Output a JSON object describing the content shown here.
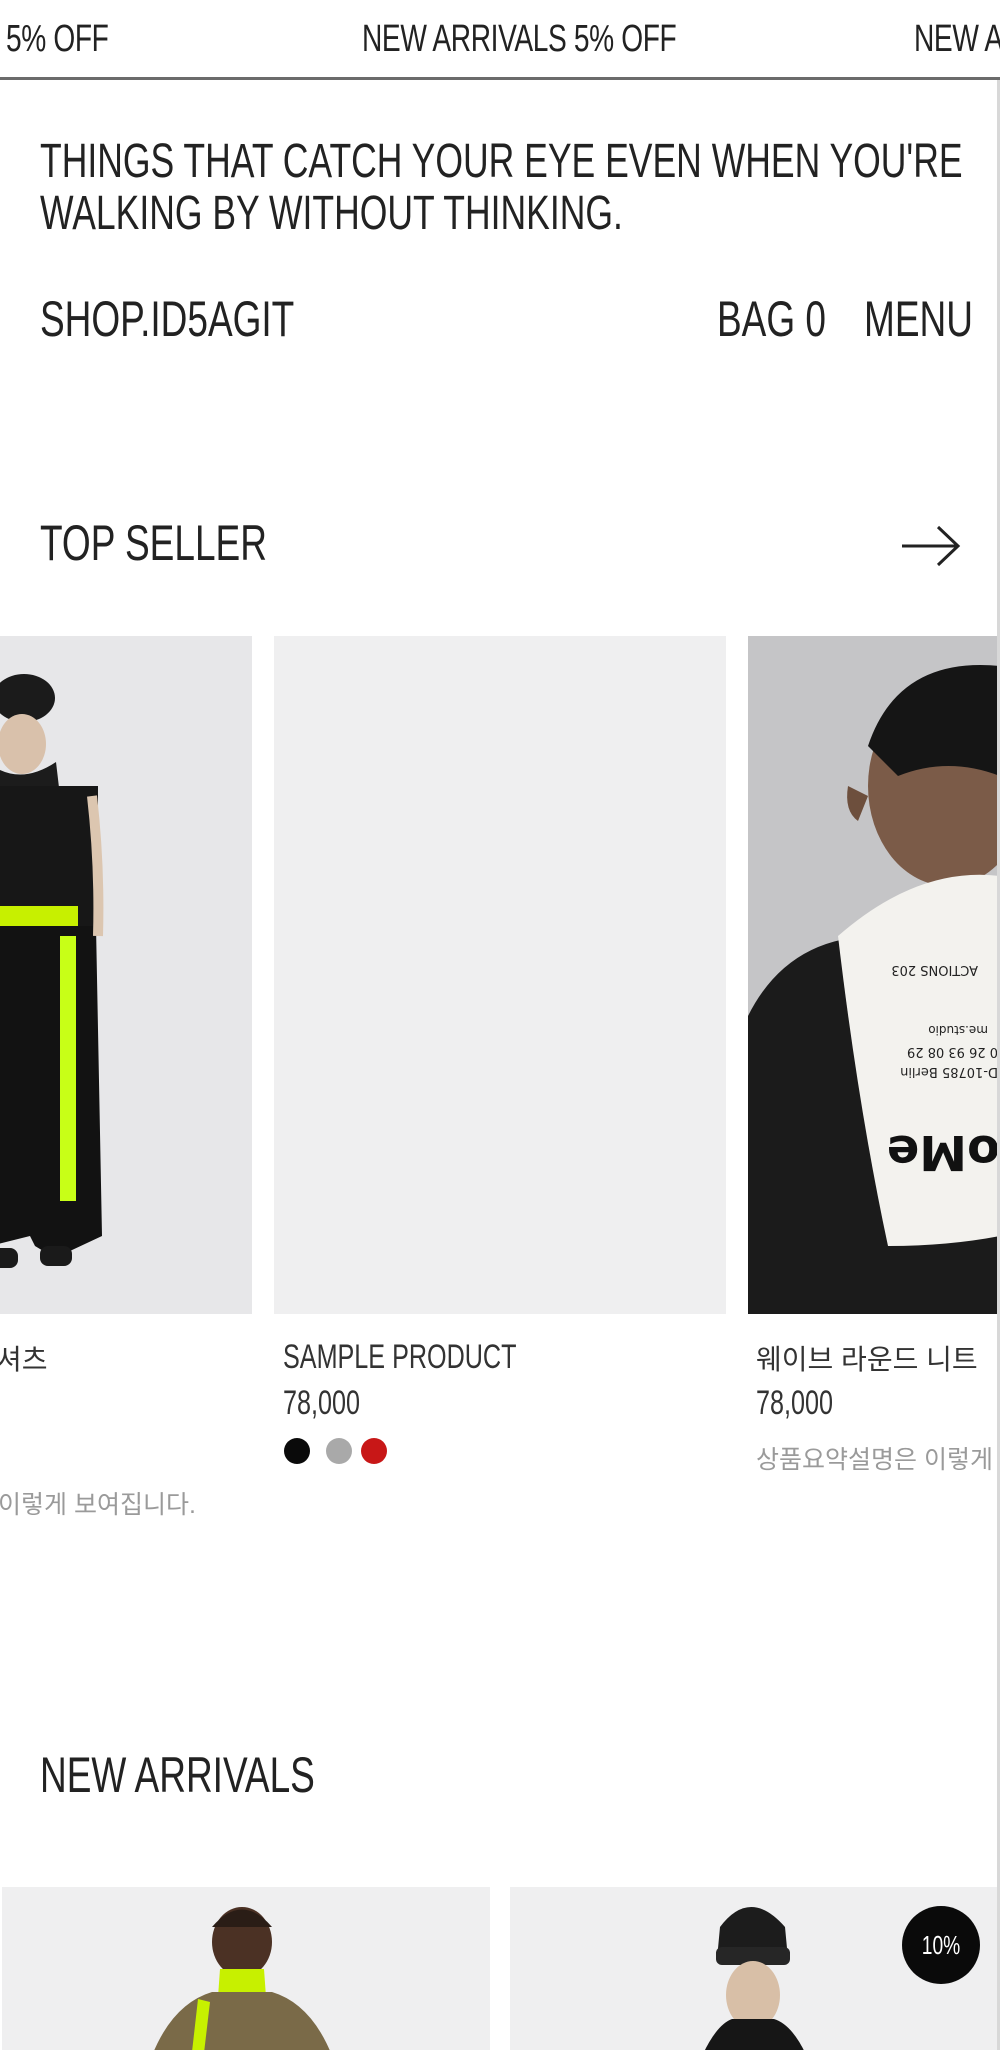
{
  "marquee": {
    "items": [
      "5% OFF",
      "NEW ARRIVALS 5% OFF",
      "NEW AR"
    ]
  },
  "header": {
    "tagline": "THINGS THAT CATCH YOUR EYE EVEN WHEN YOU'RE WALKING BY WITHOUT THINKING.",
    "logo": "SHOP.ID5AGIT",
    "bag_label": "BAG 0",
    "menu_label": "MENU"
  },
  "top_seller": {
    "title": "TOP SELLER",
    "products": [
      {
        "name": "셔츠",
        "price": "",
        "summary": "이렇게 보여집니다."
      },
      {
        "name": "SAMPLE PRODUCT",
        "price": "78,000",
        "swatches": [
          "#0a0a0a",
          "#a9a9a9",
          "#c81717"
        ]
      },
      {
        "name": "웨이브 라운드 니트",
        "price": "78,000",
        "summary": "상품요약설명은 이렇게"
      }
    ]
  },
  "new_arrivals": {
    "title": "NEW ARRIVALS",
    "badge": "10%"
  }
}
